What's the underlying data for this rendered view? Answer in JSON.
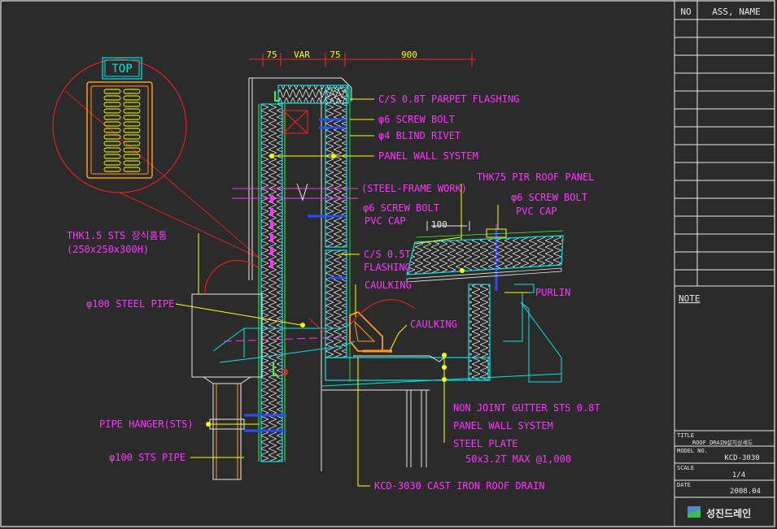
{
  "palette": {
    "background": "#2b2b2b",
    "frame": "#e8e8e8",
    "annotation": "#ff33ff",
    "leader": "#ffff00",
    "panel": "#00e5e5",
    "insulation": "#ffb4c8",
    "edge": "#e8e8e8",
    "bolt": "#2a4cff",
    "red": "#ff2020",
    "orange": "#ff9a20",
    "green": "#33ff33"
  },
  "dimensions": {
    "d1": "75",
    "d2": "VAR",
    "d3": "75",
    "d4": "900",
    "d5": "100"
  },
  "detail": {
    "top_label": "TOP"
  },
  "labels": {
    "parapet_flashing": "C/S 0.8T PARPET FLASHING",
    "screw_bolt_1": "φ6 SCREW BOLT",
    "blind_rivet": "φ4 BLIND RIVET",
    "panel_wall_system_1": "PANEL WALL SYSTEM",
    "steel_frame_work": "(STEEL-FRAME WORK)",
    "roof_panel": "THK75 PIR ROOF PANEL",
    "screw_bolt_2": "φ6 SCREW BOLT",
    "pvc_cap_2": "PVC CAP",
    "screw_bolt_3": "φ6 SCREW BOLT",
    "pvc_cap_3": "PVC CAP",
    "downspout_box": "THK1.5 STS 장식홈통",
    "downspout_box_size": "(250x250x300H)",
    "flashing": "C/S 0.5T",
    "flashing_2": "FLASHING",
    "caulking_1": "CAULKING",
    "purlin": "PURLIN",
    "steel_pipe": "φ100 STEEL PIPE",
    "caulking_2": "CAULKING",
    "gutter": "NON JOINT GUTTER STS 0.8T",
    "panel_wall_system_2": "PANEL WALL SYSTEM",
    "steel_plate": "STEEL PLATE",
    "steel_plate_spec": "50x3.2T MAX @1,000",
    "pipe_hanger": "PIPE HANGER(STS)",
    "sts_pipe": "φ100 STS PIPE",
    "roof_drain": "KCD-3030 CAST IRON ROOF DRAIN"
  },
  "title_block": {
    "col_no": "NO",
    "col_name": "ASS, NAME",
    "note": "NOTE",
    "title_label": "TITLE",
    "title_value": "ROOF DRAIN설치상세도",
    "model_label": "MODEL  NO.",
    "model_value": "KCD-3030",
    "scale_label": "SCALE",
    "scale_value": "1/4",
    "date_label": "DATE",
    "date_value": "2008.04",
    "company": "성진드레인"
  }
}
